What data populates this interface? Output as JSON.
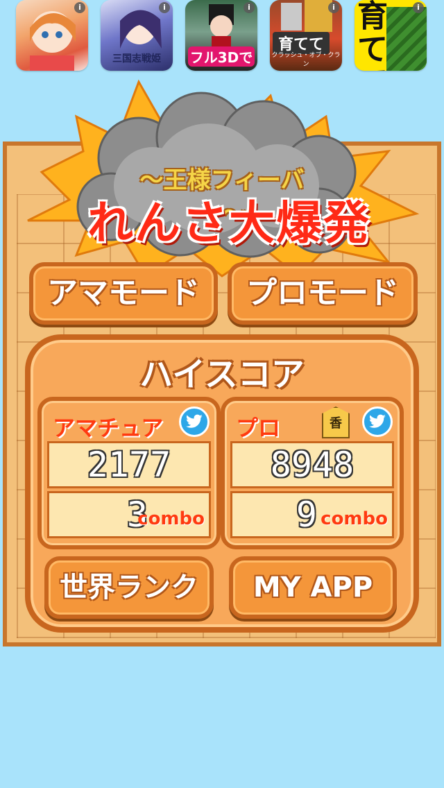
{
  "ads": [
    {
      "label": ""
    },
    {
      "label": "三国志戦姫"
    },
    {
      "label": "フル3Dで"
    },
    {
      "label": "育てて",
      "sub": "クラッシュ・オブ・クラン"
    },
    {
      "label": "育てて"
    }
  ],
  "ad_info_glyph": "i",
  "title": {
    "subtitle": "〜王様フィーバー〜",
    "main": "れんさ大爆発"
  },
  "buttons": {
    "amateur_mode": "アマモード",
    "pro_mode": "プロモード",
    "world_rank": "世界ランク",
    "my_app": "MY APP"
  },
  "highscore": {
    "title": "ハイスコア",
    "amateur": {
      "label": "アマチュア",
      "score": "2177",
      "combo": "3",
      "combo_word": "combo"
    },
    "pro": {
      "label": "プロ",
      "badge": "香",
      "score": "8948",
      "combo": "9",
      "combo_word": "combo"
    }
  },
  "colors": {
    "background": "#a9e3fb",
    "board": "#f3c07a",
    "button": "#f4963a",
    "accent_red": "#ff2a16",
    "twitter": "#2ea7e8"
  }
}
